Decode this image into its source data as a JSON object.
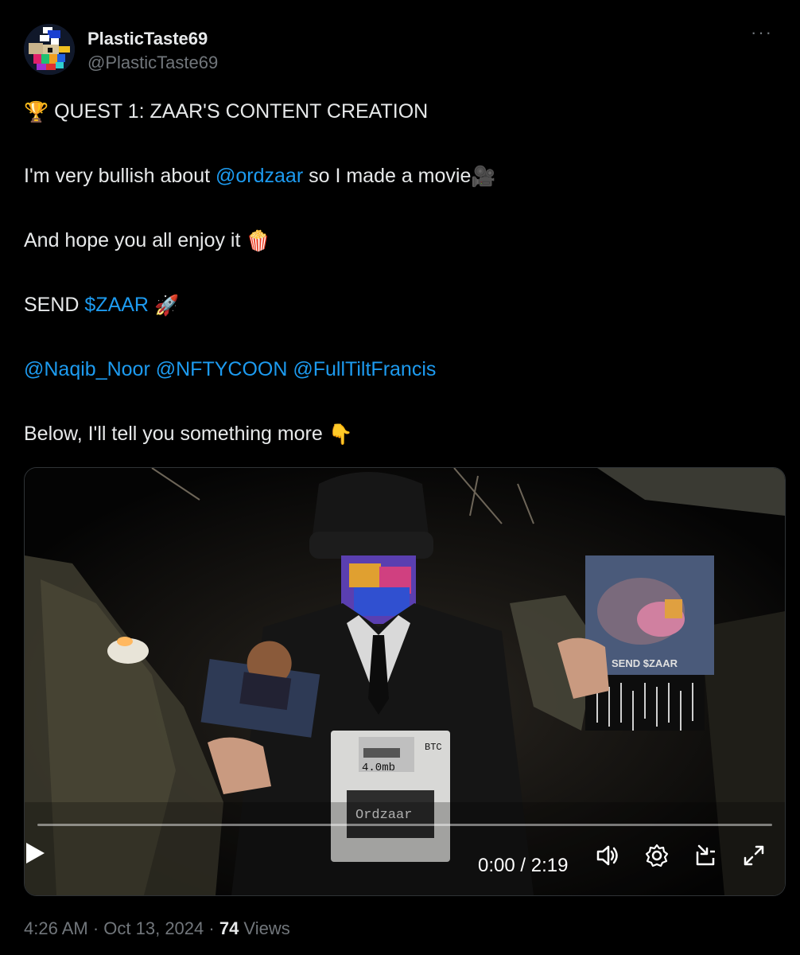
{
  "author": {
    "name": "PlasticTaste69",
    "handle": "@PlasticTaste69",
    "more_label": "···"
  },
  "tweet": {
    "line1": {
      "emoji": "🏆",
      "text": " QUEST 1: ZAAR'S CONTENT CREATION"
    },
    "line2": {
      "before": "I'm very bullish about ",
      "mention": "@ordzaar",
      "after": " so I made a movie",
      "emoji": "🎥"
    },
    "line3": {
      "text": "And hope you all enjoy it ",
      "emoji": "🍿"
    },
    "line4": {
      "before": "SEND ",
      "cashtag": "$ZAAR",
      "emoji": "🚀"
    },
    "line5": {
      "mentions": [
        "@Naqib_Noor",
        "@NFTYCOON",
        "@FullTiltFrancis"
      ]
    },
    "line6": {
      "text": "Below, I'll tell you something more ",
      "emoji": "👇"
    }
  },
  "video": {
    "time_display": "0:00 / 2:19",
    "progress": 0,
    "floppy_size": "4.0mb",
    "floppy_brand": "Ordzaar",
    "floppy_tag": "BTC",
    "poster_caption": "SEND $ZAAR",
    "icons": [
      "play-icon",
      "volume-icon",
      "settings-icon",
      "pop-out-icon",
      "fullscreen-icon"
    ]
  },
  "meta": {
    "time": "4:26 AM",
    "separator": " · ",
    "date": "Oct 13, 2024",
    "views_count": "74",
    "views_label": " Views"
  },
  "colors": {
    "background": "#000000",
    "text": "#e7e9ea",
    "secondary": "#71767b",
    "link": "#1d9bf0",
    "border": "#2f3336"
  }
}
